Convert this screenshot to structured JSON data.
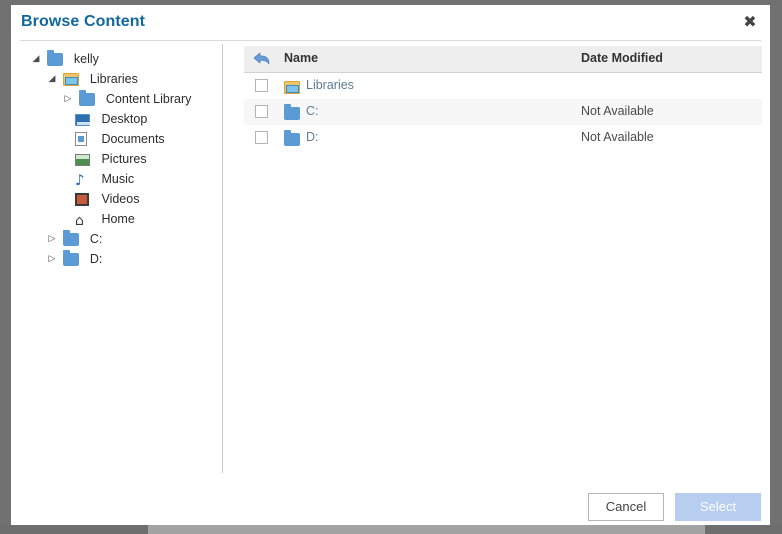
{
  "dialog": {
    "title": "Browse Content",
    "close_label": "✖"
  },
  "tree": {
    "items": [
      {
        "label": "kelly",
        "icon": "folder-blue-icon",
        "twisty": "◢",
        "indent": 0
      },
      {
        "label": "Libraries",
        "icon": "library-folder-icon",
        "twisty": "◢",
        "indent": 1
      },
      {
        "label": "Content Library",
        "icon": "folder-blue-icon",
        "twisty": "▷",
        "indent": 2
      },
      {
        "label": "Desktop",
        "icon": "desktop-icon",
        "twisty": "",
        "indent": 2
      },
      {
        "label": "Documents",
        "icon": "document-icon",
        "twisty": "",
        "indent": 2
      },
      {
        "label": "Pictures",
        "icon": "picture-icon",
        "twisty": "",
        "indent": 2
      },
      {
        "label": "Music",
        "icon": "music-note-icon",
        "twisty": "",
        "indent": 2
      },
      {
        "label": "Videos",
        "icon": "video-film-icon",
        "twisty": "",
        "indent": 2
      },
      {
        "label": "Home",
        "icon": "home-icon",
        "twisty": "",
        "indent": 2
      },
      {
        "label": "C:",
        "icon": "folder-blue-icon",
        "twisty": "▷",
        "indent": 1
      },
      {
        "label": "D:",
        "icon": "folder-blue-icon",
        "twisty": "▷",
        "indent": 1
      }
    ]
  },
  "filelist": {
    "columns": {
      "name": "Name",
      "date_modified": "Date Modified"
    },
    "rows": [
      {
        "name": "Libraries",
        "date_modified": "",
        "icon": "library-folder-icon",
        "checked": false
      },
      {
        "name": "C:",
        "date_modified": "Not Available",
        "icon": "folder-blue-icon",
        "checked": false
      },
      {
        "name": "D:",
        "date_modified": "Not Available",
        "icon": "folder-blue-icon",
        "checked": false
      }
    ]
  },
  "footer": {
    "cancel_label": "Cancel",
    "select_label": "Select"
  },
  "colors": {
    "title": "#12689e",
    "select_button_bg": "#b8cef0",
    "row_name_text": "#5f7c94",
    "frame": "#6e6e6e"
  }
}
